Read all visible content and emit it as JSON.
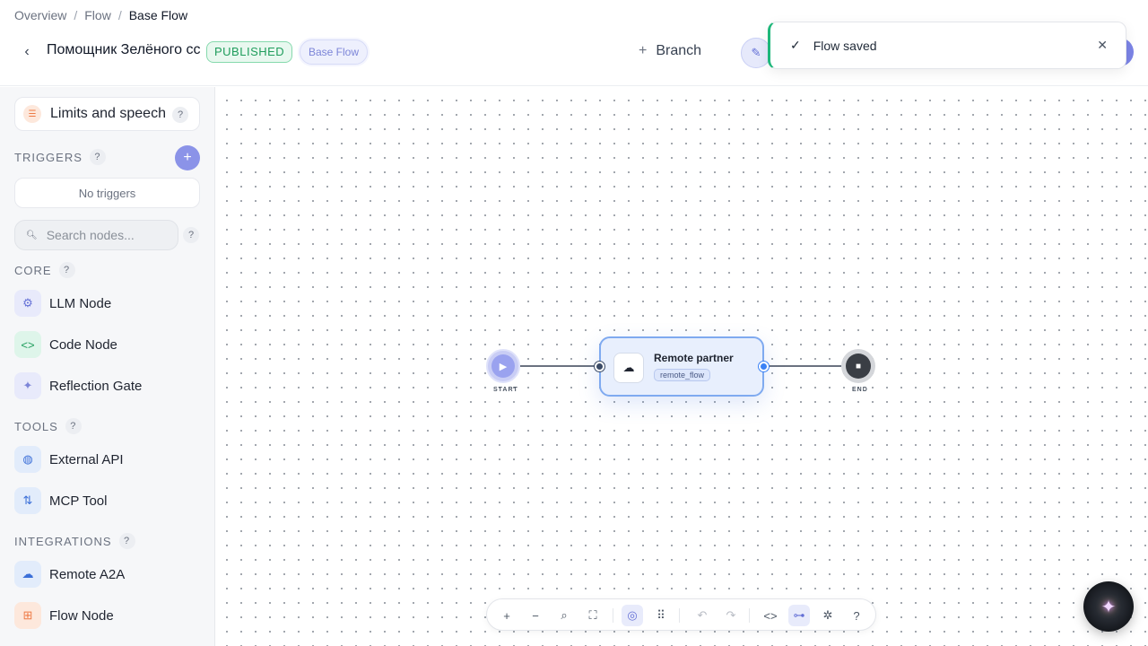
{
  "breadcrumb": {
    "items": [
      "Overview",
      "Flow",
      "Base Flow"
    ],
    "separator": "/"
  },
  "header": {
    "title": "Помощник Зелёного сс",
    "status_badge": "PUBLISHED",
    "flow_badge": "Base Flow",
    "branch_label": "Branch"
  },
  "toast": {
    "message": "Flow saved"
  },
  "sidebar": {
    "limits_label": "Limits and speech",
    "help_mark": "?",
    "triggers_title": "TRIGGERS",
    "no_triggers": "No triggers",
    "search_placeholder": "Search nodes...",
    "sections": {
      "core": "CORE",
      "tools": "TOOLS",
      "integrations": "INTEGRATIONS"
    },
    "core_items": [
      "LLM Node",
      "Code Node",
      "Reflection Gate"
    ],
    "tool_items": [
      "External API",
      "MCP Tool"
    ],
    "integration_items": [
      "Remote A2A",
      "Flow Node"
    ]
  },
  "canvas": {
    "start_label": "START",
    "end_label": "END",
    "remote_node": {
      "title": "Remote partner",
      "tag": "remote_flow"
    }
  },
  "colors": {
    "accent": "#8b93e8",
    "published": "#1f9d5c",
    "toast_bar": "#1eb77a",
    "node_border": "#7faaf0"
  }
}
